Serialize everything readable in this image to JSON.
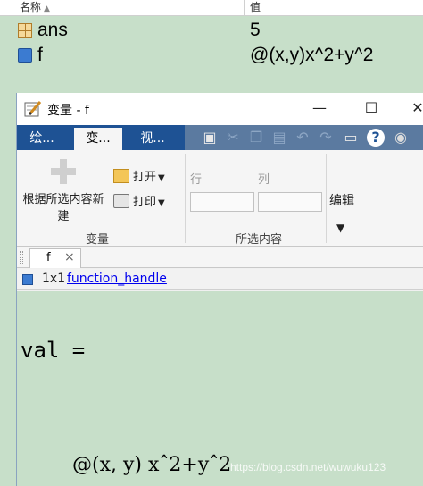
{
  "workspace": {
    "header": {
      "name": "名称",
      "value": "值"
    },
    "rows": [
      {
        "name": "ans",
        "value": "5",
        "icon": "table-icon"
      },
      {
        "name": "f",
        "value": "@(x,y)x^2+y^2",
        "icon": "function-handle-icon"
      }
    ],
    "colors": {
      "background": "#c7dfc9"
    }
  },
  "editor": {
    "title": "变量 - f",
    "window_buttons": {
      "minimize": "—",
      "maximize": "☐",
      "close": "✕"
    },
    "ribbon_tabs": [
      "绘...",
      "变...",
      "视..."
    ],
    "active_tab": "变...",
    "ribbon": {
      "new_from_selection": "根据所选内容新建",
      "open": "打开",
      "print": "打印",
      "variable_section": "变量",
      "row": "行",
      "column": "列",
      "selection_section": "所选内容",
      "edit": "编辑"
    },
    "doc_tab": "f",
    "type_bar": {
      "size": "1x1",
      "class_link": "function_handle"
    },
    "output": {
      "line1": "val =",
      "line2": "@(x, y) xˆ2+yˆ2"
    },
    "colors": {
      "tabstrip": "#1e5294",
      "content_bg": "#c7dfc9",
      "link": "#0000ee"
    }
  },
  "watermark": "https://blog.csdn.net/wuwuku123"
}
